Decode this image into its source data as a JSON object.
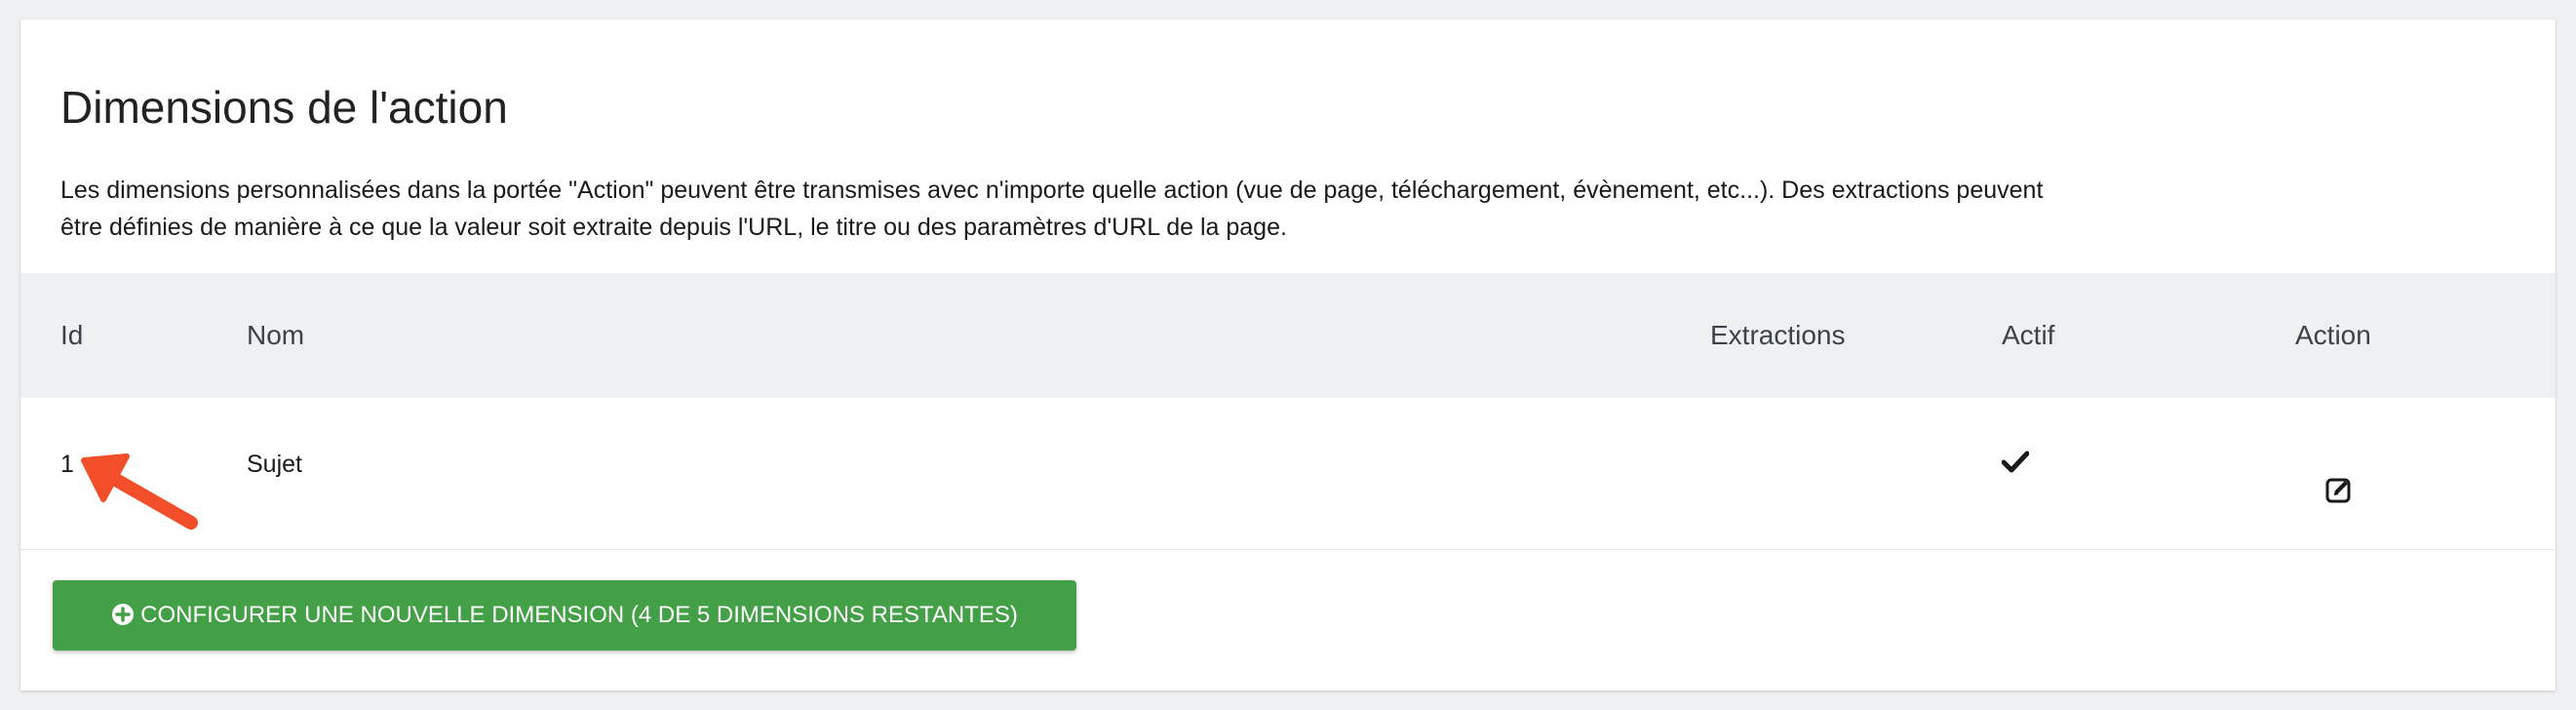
{
  "section": {
    "title": "Dimensions de l'action",
    "description": "Les dimensions personnalisées dans la portée \"Action\" peuvent être transmises avec n'importe quelle action (vue de page, téléchargement, évènement, etc...). Des extractions peuvent être définies de manière à ce que la valeur soit extraite depuis l'URL, le titre ou des paramètres d'URL de la page."
  },
  "table": {
    "headers": {
      "id": "Id",
      "name": "Nom",
      "extractions": "Extractions",
      "active": "Actif",
      "action": "Action"
    },
    "rows": [
      {
        "id": "1",
        "name": "Sujet",
        "extractions": "",
        "active": true
      }
    ]
  },
  "button": {
    "label": "CONFIGURER UNE NOUVELLE DIMENSION (4 DE 5 DIMENSIONS RESTANTES)"
  },
  "icons": {
    "active": "check-icon",
    "edit": "edit-icon",
    "button": "plus-circle-icon",
    "annotation": "arrow-icon"
  },
  "colors": {
    "button": "#43a047",
    "annotation_arrow": "#f24e2a",
    "header_bg": "#eff0f2"
  }
}
